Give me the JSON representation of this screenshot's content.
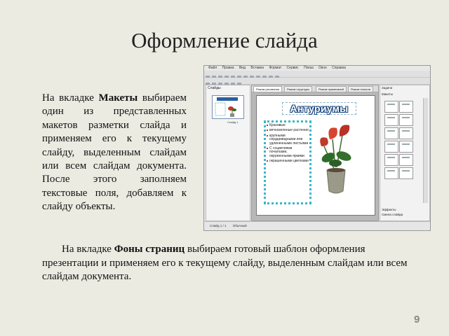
{
  "slide_title": "Оформление слайда",
  "left_paragraph": {
    "before": "На вкладке ",
    "bold": "Макеты",
    "after": " выбираем один из представленных макетов разметки слайда и применяем его к текущему слайду, выделенным слайдам или всем слайдам документа. После этого заполняем текстовые поля, добавляем к слайду объекты."
  },
  "bottom_paragraph": {
    "before": "На вкладке ",
    "bold": "Фоны страниц",
    "after": " выбираем готовый шаблон оформления презентации и применяем его к текущему слайду, выделенным слайдам или всем слайдам документа."
  },
  "page_number": "9",
  "screenshot": {
    "menu": [
      "Файл",
      "Правка",
      "Вид",
      "Вставка",
      "Формат",
      "Сервис",
      "Показ",
      "Окно",
      "Справка"
    ],
    "slides_pane_title": "Слайды",
    "thumb_caption": "Слайд 1",
    "view_tabs": [
      "Режим рисования",
      "Режим структуры",
      "Режим примечаний",
      "Режим тезисов"
    ],
    "slide_heading": "Антуриумы",
    "slide_bullets": [
      "Красивые",
      "вечнозеленые растения",
      "крупными сердцевидными или удлиненными листьями",
      "С соцветиями початками, окруженными яркими",
      "окрашенными цветками"
    ],
    "tasks_title": "Задачи",
    "tasks_section": "Макеты",
    "tasks_bottom": [
      "Эффекты",
      "Смена слайда"
    ],
    "status_items": [
      "Слайд 1 / 1",
      "Обычный"
    ]
  }
}
